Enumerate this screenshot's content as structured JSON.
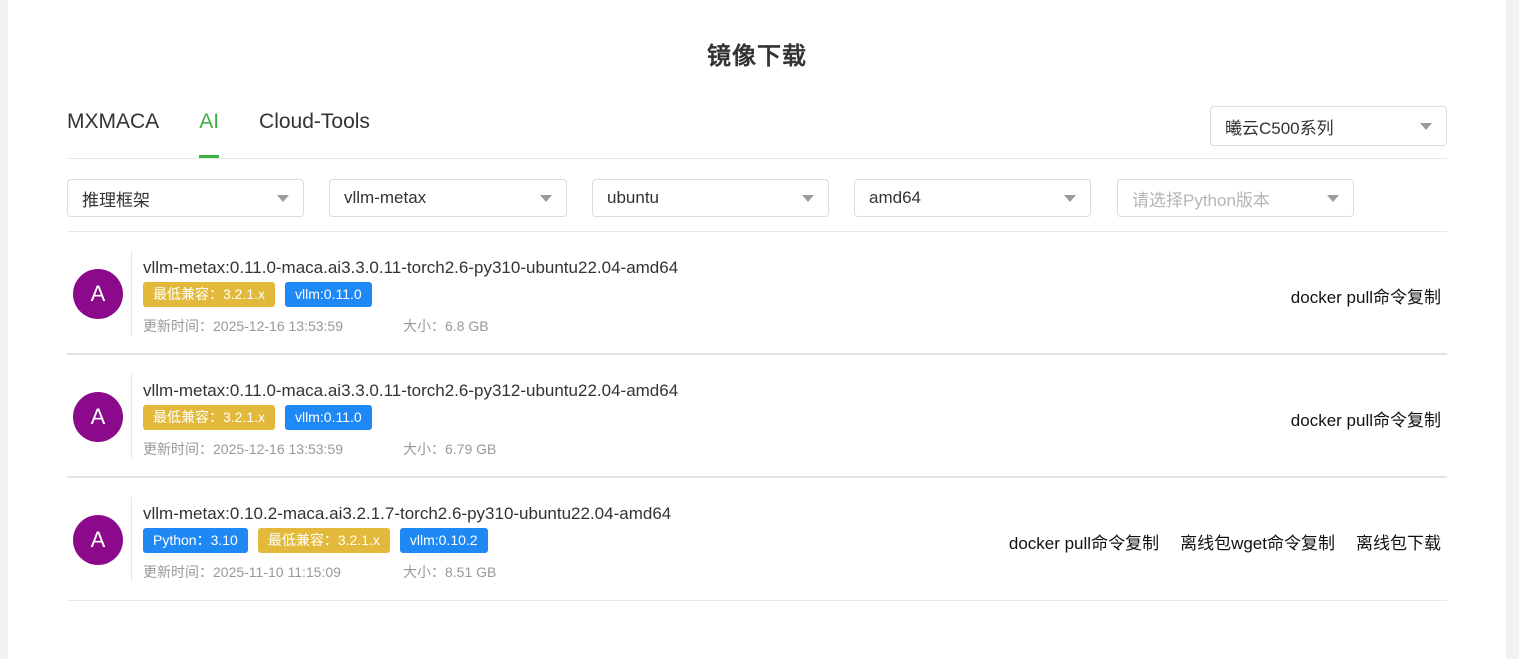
{
  "page": {
    "title": "镜像下载"
  },
  "tabs": [
    {
      "label": "MXMACA",
      "active": false
    },
    {
      "label": "AI",
      "active": true
    },
    {
      "label": "Cloud-Tools",
      "active": false
    }
  ],
  "series_select": {
    "value": "曦云C500系列"
  },
  "filters": [
    {
      "value": "推理框架",
      "placeholder": false
    },
    {
      "value": "vllm-metax",
      "placeholder": false
    },
    {
      "value": "ubuntu",
      "placeholder": false
    },
    {
      "value": "amd64",
      "placeholder": false
    },
    {
      "value": "请选择Python版本",
      "placeholder": true
    }
  ],
  "colors": {
    "accent": "#3cb043",
    "tag_yellow": "#e2b93b",
    "tag_blue": "#1e88f5",
    "avatar": "#8b0a8b"
  },
  "items": [
    {
      "avatar": "A",
      "name": "vllm-metax:0.11.0-maca.ai3.3.0.11-torch2.6-py310-ubuntu22.04-amd64",
      "tags": [
        {
          "label": "最低兼容：3.2.1.x",
          "color": "yellow"
        },
        {
          "label": "vllm:0.11.0",
          "color": "blue"
        }
      ],
      "updated": "更新时间：2025-12-16 13:53:59",
      "size": "大小：6.8 GB",
      "actions": [
        "docker pull命令复制"
      ]
    },
    {
      "avatar": "A",
      "name": "vllm-metax:0.11.0-maca.ai3.3.0.11-torch2.6-py312-ubuntu22.04-amd64",
      "tags": [
        {
          "label": "最低兼容：3.2.1.x",
          "color": "yellow"
        },
        {
          "label": "vllm:0.11.0",
          "color": "blue"
        }
      ],
      "updated": "更新时间：2025-12-16 13:53:59",
      "size": "大小：6.79 GB",
      "actions": [
        "docker pull命令复制"
      ]
    },
    {
      "avatar": "A",
      "name": "vllm-metax:0.10.2-maca.ai3.2.1.7-torch2.6-py310-ubuntu22.04-amd64",
      "tags": [
        {
          "label": "Python：3.10",
          "color": "blue"
        },
        {
          "label": "最低兼容：3.2.1.x",
          "color": "yellow"
        },
        {
          "label": "vllm:0.10.2",
          "color": "blue"
        }
      ],
      "updated": "更新时间：2025-11-10 11:15:09",
      "size": "大小：8.51 GB",
      "actions": [
        "docker pull命令复制",
        "离线包wget命令复制",
        "离线包下载"
      ]
    }
  ]
}
